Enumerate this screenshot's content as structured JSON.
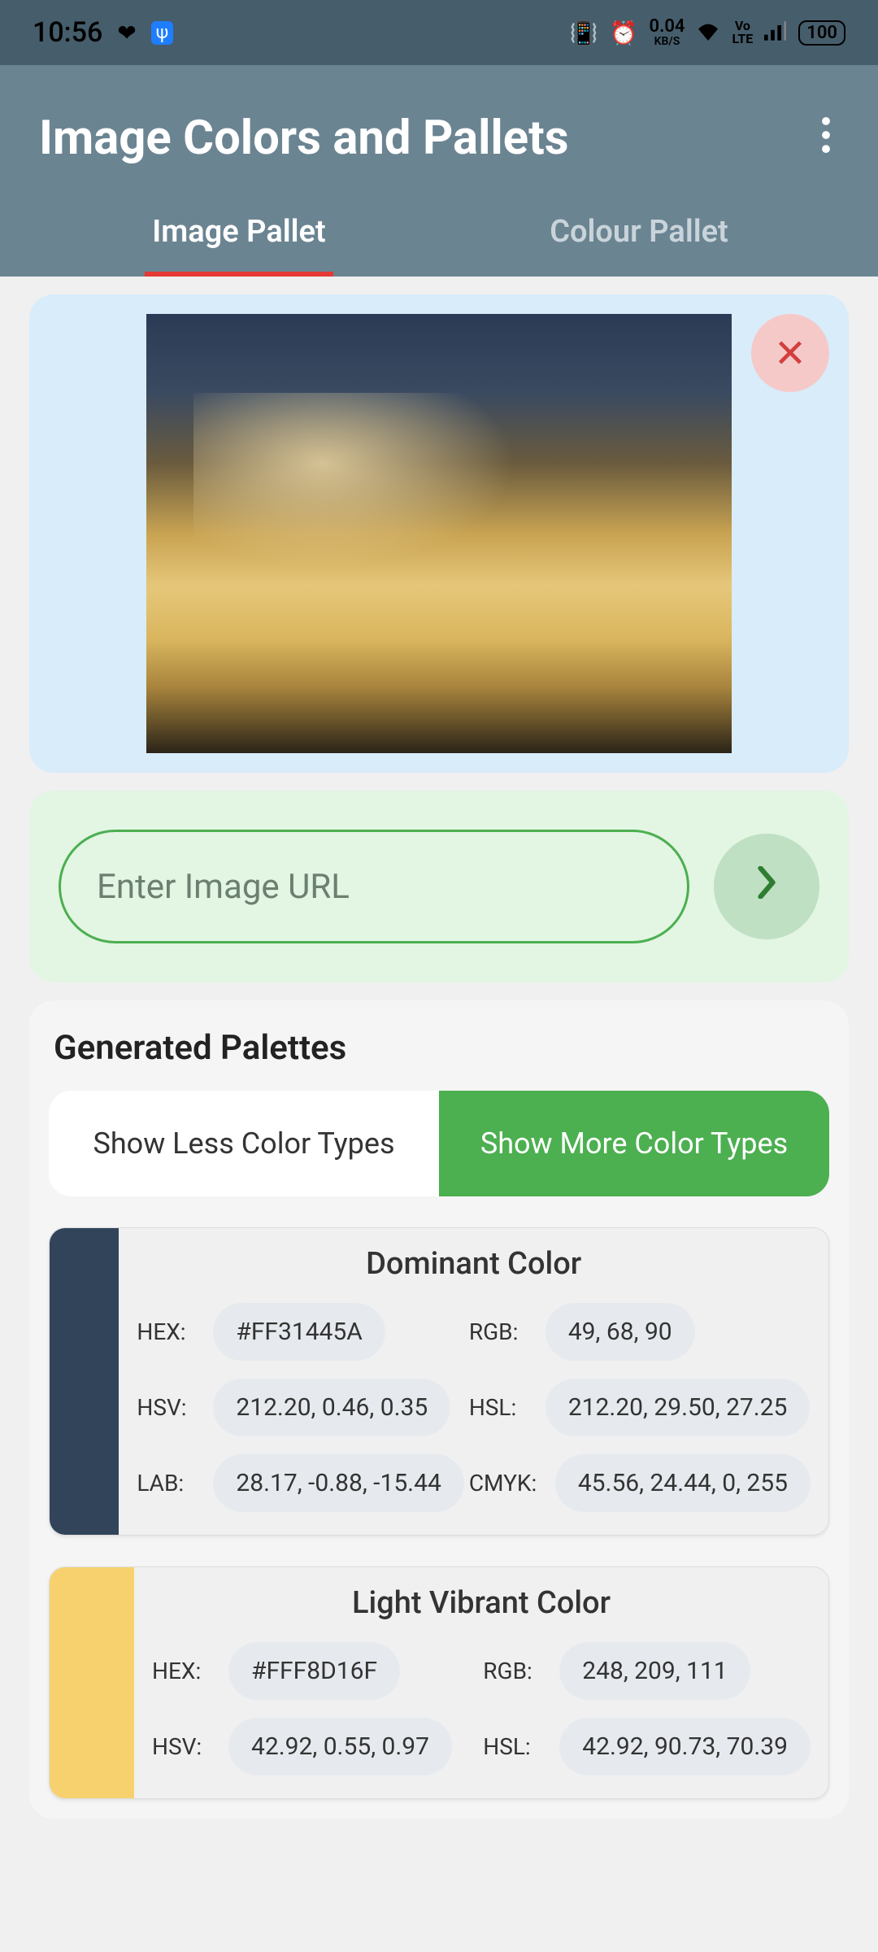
{
  "status": {
    "time": "10:56",
    "kbs_top": "0.04",
    "kbs_bot": "KB/S",
    "battery": "100"
  },
  "header": {
    "title": "Image Colors and Pallets"
  },
  "tabs": {
    "image": "Image Pallet",
    "colour": "Colour Pallet"
  },
  "url": {
    "placeholder": "Enter Image URL"
  },
  "palettes": {
    "title": "Generated Palettes",
    "show_less": "Show Less Color Types",
    "show_more": "Show More Color Types"
  },
  "colors": {
    "dominant": {
      "title": "Dominant Color",
      "swatch": "#31445a",
      "hex": "#FF31445A",
      "rgb": "49, 68, 90",
      "hsv": "212.20, 0.46, 0.35",
      "hsl": "212.20, 29.50, 27.25",
      "lab": "28.17, -0.88, -15.44",
      "cmyk": "45.56, 24.44, 0, 255"
    },
    "light_vibrant": {
      "title": "Light Vibrant Color",
      "swatch": "#f8d16f",
      "hex": "#FFF8D16F",
      "rgb": "248, 209, 111",
      "hsv": "42.92, 0.55, 0.97",
      "hsl": "42.92, 90.73, 70.39"
    }
  },
  "labels": {
    "hex": "HEX:",
    "rgb": "RGB:",
    "hsv": "HSV:",
    "hsl": "HSL:",
    "lab": "LAB:",
    "cmyk": "CMYK:"
  }
}
